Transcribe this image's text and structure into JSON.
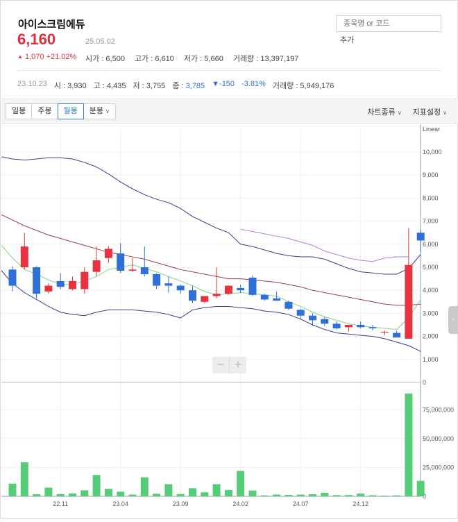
{
  "stock": {
    "name": "아이스크림에듀",
    "price": "6,160",
    "date": "25.05.02",
    "change": "1,070",
    "change_rate": "+21.02%",
    "open": "시가 : 6,500",
    "high": "고가 : 6,610",
    "low": "저가 : 5,660",
    "volume": "거래량 : 13,397,197"
  },
  "search": {
    "placeholder": "종목명 or 코드",
    "add_label": "추가"
  },
  "previous": {
    "date": "23.10.23",
    "open": "시 : 3,930",
    "high": "고 : 4,435",
    "low": "저 : 3,755",
    "close_label": "종 :",
    "close": "3,785",
    "change": "▼-150",
    "rate": "-3.81%",
    "volume": "거래량 : 5,949,176"
  },
  "toolbar": {
    "tabs": [
      "일봉",
      "주봉",
      "월봉",
      "분봉"
    ],
    "active_tab": "월봉",
    "chart_type": "차트종류",
    "indicator": "지표설정"
  },
  "colors": {
    "up": "#e8323f",
    "down": "#2f6fd8",
    "volume": "#55cc77",
    "ma5": "#7fd48a",
    "ma20": "#9b3b45",
    "ma60": "#b57cdc",
    "band": "#3b3b8f"
  },
  "chart_data": {
    "type": "candlestick",
    "scale_label": "Linear",
    "x_tick_labels": [
      "22.11",
      "23.04",
      "23.09",
      "24.02",
      "24.07",
      "24.12"
    ],
    "x_tick_index": [
      4,
      9,
      14,
      19,
      24,
      29
    ],
    "price_axis": {
      "ticks": [
        0,
        1000,
        2000,
        3000,
        4000,
        5000,
        6000,
        7000,
        8000,
        9000,
        10000
      ],
      "ylim": [
        0,
        10000
      ]
    },
    "volume_axis": {
      "ticks": [
        0,
        25000000,
        50000000,
        75000000
      ],
      "tick_labels": [
        "0",
        "25,000,000",
        "50,000,000",
        "75,000,000"
      ],
      "ylim": [
        0,
        95000000
      ]
    },
    "ohlc": [
      [
        4900,
        5050,
        3950,
        4200
      ],
      [
        5000,
        6500,
        4900,
        5900
      ],
      [
        5000,
        5050,
        3650,
        3850
      ],
      [
        3950,
        4300,
        3850,
        4200
      ],
      [
        4400,
        4750,
        4050,
        4150
      ],
      [
        4050,
        4600,
        4000,
        4400
      ],
      [
        4050,
        5000,
        3850,
        4800
      ],
      [
        4800,
        5900,
        4600,
        5300
      ],
      [
        5400,
        5900,
        5200,
        5800
      ],
      [
        5600,
        6050,
        4750,
        4850
      ],
      [
        4850,
        5400,
        4800,
        4900
      ],
      [
        5000,
        5900,
        4600,
        4700
      ],
      [
        4700,
        4750,
        4050,
        4200
      ],
      [
        4300,
        4600,
        3900,
        4200
      ],
      [
        4200,
        4250,
        3850,
        4000
      ],
      [
        4000,
        4200,
        3450,
        3550
      ],
      [
        3500,
        3750,
        3450,
        3750
      ],
      [
        3750,
        5000,
        3650,
        3850
      ],
      [
        3850,
        4200,
        3800,
        4200
      ],
      [
        4100,
        4250,
        3900,
        4000
      ],
      [
        4550,
        4650,
        3750,
        3800
      ],
      [
        3800,
        3850,
        3550,
        3600
      ],
      [
        3650,
        3950,
        3550,
        3550
      ],
      [
        3500,
        3550,
        3150,
        3200
      ],
      [
        3150,
        3200,
        2750,
        2900
      ],
      [
        2900,
        3000,
        2450,
        2700
      ],
      [
        2750,
        2850,
        2450,
        2550
      ],
      [
        2550,
        2650,
        2300,
        2350
      ],
      [
        2400,
        2500,
        2200,
        2500
      ],
      [
        2500,
        2650,
        2350,
        2400
      ],
      [
        2400,
        2500,
        2250,
        2350
      ],
      [
        2200,
        2250,
        2050,
        2200
      ],
      [
        2150,
        2250,
        1950,
        1950
      ],
      [
        1900,
        6700,
        1900,
        5100
      ],
      [
        6500,
        6610,
        5660,
        6160
      ]
    ],
    "volume": [
      11000000,
      29500000,
      1800000,
      7500000,
      2000000,
      2500000,
      5200000,
      18500000,
      6500000,
      4000000,
      1500000,
      16500000,
      2200000,
      10500000,
      2000000,
      7000000,
      3500000,
      10500000,
      5500000,
      22000000,
      5000000,
      800000,
      1500000,
      1200000,
      1500000,
      1800000,
      3000000,
      1000000,
      1100000,
      2400000,
      900000,
      600000,
      800000,
      89000000,
      13400000
    ],
    "ma5": [
      6000,
      5400,
      4900,
      4700,
      4450,
      4250,
      4250,
      4400,
      4600,
      4900,
      5000,
      5100,
      4950,
      4800,
      4600,
      4400,
      4200,
      3950,
      3800,
      3850,
      3900,
      3850,
      3800,
      3750,
      3500,
      3300,
      3050,
      2850,
      2700,
      2550,
      2450,
      2400,
      2350,
      2300,
      2800,
      3600
    ],
    "ma20": [
      7300,
      7050,
      6800,
      6600,
      6400,
      6250,
      6100,
      5950,
      5800,
      5650,
      5550,
      5450,
      5350,
      5200,
      5050,
      4900,
      4800,
      4700,
      4600,
      4500,
      4500,
      4450,
      4400,
      4350,
      4250,
      4150,
      4000,
      3900,
      3800,
      3700,
      3600,
      3500,
      3400,
      3350,
      3350,
      3400
    ],
    "ma60_start": 20,
    "ma60": [
      6650,
      6550,
      6450,
      6350,
      6250,
      6100,
      5950,
      5700,
      5550,
      5400,
      5300,
      5250,
      5400,
      5450,
      5450
    ],
    "bb_upper": [
      9800,
      9700,
      9650,
      9700,
      9750,
      9750,
      9700,
      9550,
      9350,
      9050,
      8700,
      8400,
      8150,
      7950,
      7800,
      7550,
      7200,
      6950,
      6700,
      6500,
      6000,
      5900,
      5750,
      5600,
      5500,
      5450,
      5450,
      5350,
      5150,
      4950,
      4800,
      4750,
      4700,
      4700,
      4950,
      5550
    ],
    "bb_lower": [
      4900,
      4300,
      3900,
      3600,
      3300,
      3050,
      2950,
      2900,
      3050,
      3150,
      3150,
      3150,
      3100,
      3050,
      2950,
      2800,
      3150,
      3250,
      3300,
      3300,
      3250,
      3200,
      3100,
      3050,
      2950,
      2750,
      2500,
      2300,
      2150,
      2100,
      2050,
      2000,
      1900,
      1750,
      1600,
      1350
    ]
  }
}
